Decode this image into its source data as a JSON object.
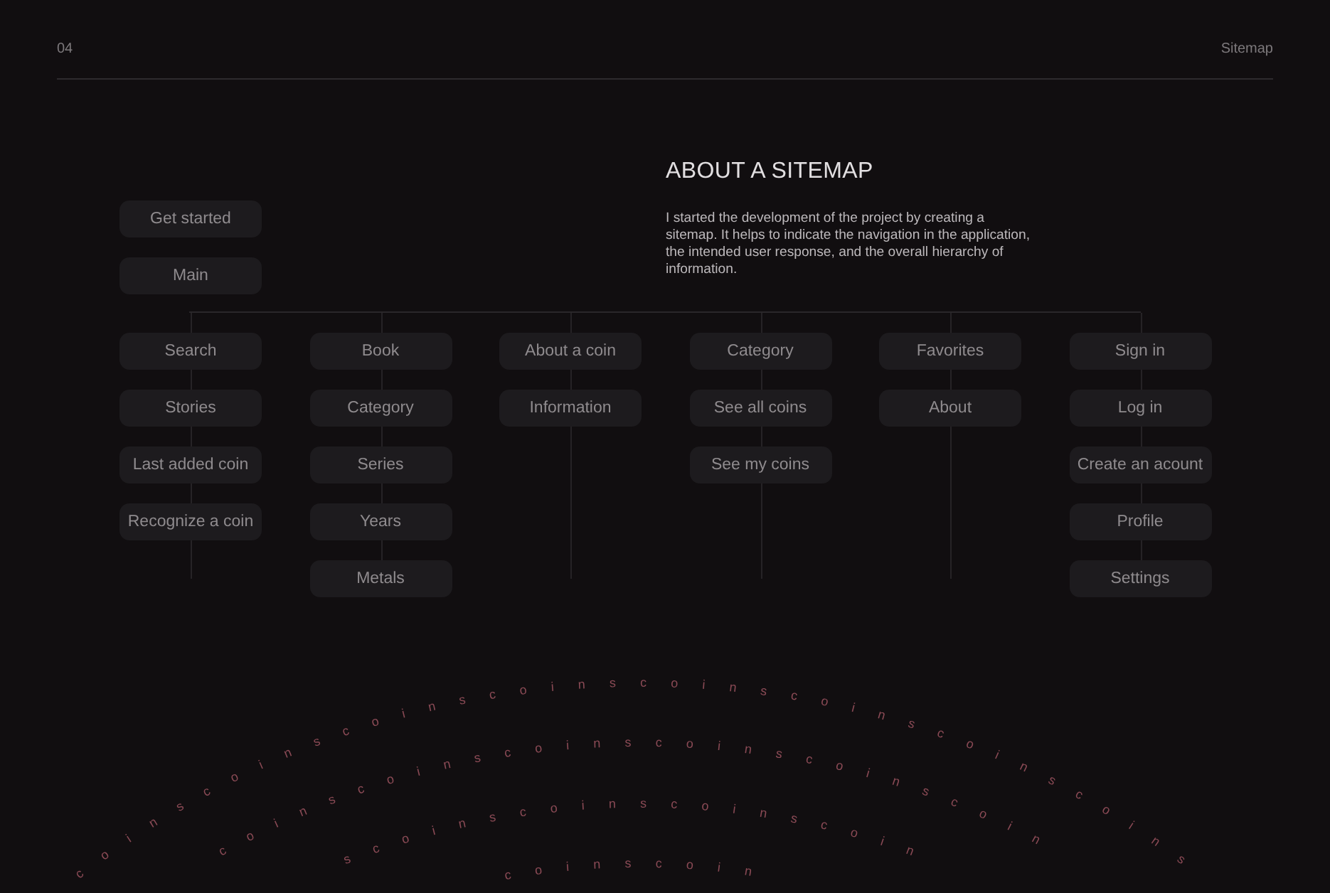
{
  "header": {
    "page_number": "04",
    "section": "Sitemap"
  },
  "about": {
    "title": "ABOUT A SITEMAP",
    "body": "I started the development of the project by creating a sitemap. It helps to indicate the navigation in the application, the intended user response, and the overall hierarchy of information."
  },
  "sitemap": {
    "root": [
      "Get started",
      "Main"
    ],
    "columns": [
      [
        "Search",
        "Stories",
        "Last added coin",
        "Recognize a coin"
      ],
      [
        "Book",
        "Category",
        "Series",
        "Years",
        "Metals"
      ],
      [
        "About a coin",
        "Information"
      ],
      [
        "Category",
        "See all coins",
        "See my coins"
      ],
      [
        "Favorites",
        "About"
      ],
      [
        "Sign in",
        "Log in",
        "Create an acount",
        "Profile",
        "Settings"
      ]
    ]
  },
  "decoration": {
    "arcs": [
      "coinscoinscoinscoinscoinscoinscoinscoins",
      "coinscoinscoinscoinscoinscoin",
      "scoinscoinscoinscoin",
      "coinscoin"
    ]
  }
}
